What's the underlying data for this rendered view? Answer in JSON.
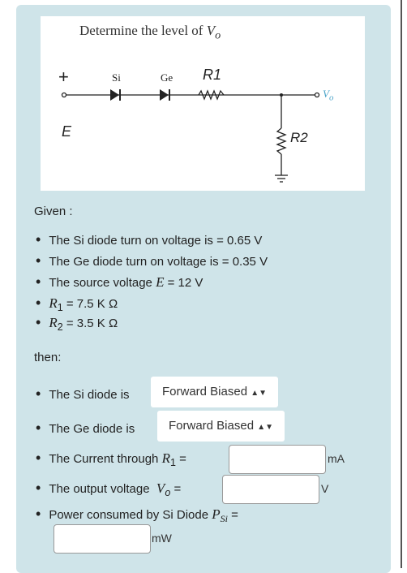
{
  "figure": {
    "title": "Determine the level of",
    "title_var": "V",
    "title_sub": "o",
    "labels": {
      "plus": "+",
      "E": "E",
      "si": "Si",
      "ge": "Ge",
      "r1": "R1",
      "r2": "R2",
      "vo": "V",
      "vo_sub": "o"
    }
  },
  "given": {
    "heading": "Given :",
    "items": [
      "The Si diode turn on voltage is = 0.65 V",
      "The Ge diode turn on voltage is =  0.35 V"
    ],
    "source_prefix": "The source voltage",
    "source_var": "E",
    "source_value": "= 12 V",
    "r1_var": "R",
    "r1_sub": "1",
    "r1_value": "= 7.5 K Ω",
    "r2_var": "R",
    "r2_sub": "2",
    "r2_value": "= 3.5 K Ω"
  },
  "then": {
    "heading": "then:",
    "si_label": "The Si diode is",
    "si_value": "Forward Biased",
    "ge_label": "The Ge diode is",
    "ge_value": "Forward Biased",
    "current_label": "The Current through",
    "current_var": "R",
    "current_sub": "1",
    "current_eq": "=",
    "current_value": "",
    "current_unit": "mA",
    "vo_label": "The output voltage",
    "vo_var": "V",
    "vo_sub": "o",
    "vo_eq": "=",
    "vo_value": "",
    "vo_unit": "V",
    "power_label": "Power consumed by Si Diode",
    "power_var": "P",
    "power_sub": "Si",
    "power_eq": "=",
    "power_value": "",
    "power_unit": "mW"
  },
  "colors": {
    "panel": "#cfe4e9",
    "vo_label": "#4aa3c8"
  }
}
